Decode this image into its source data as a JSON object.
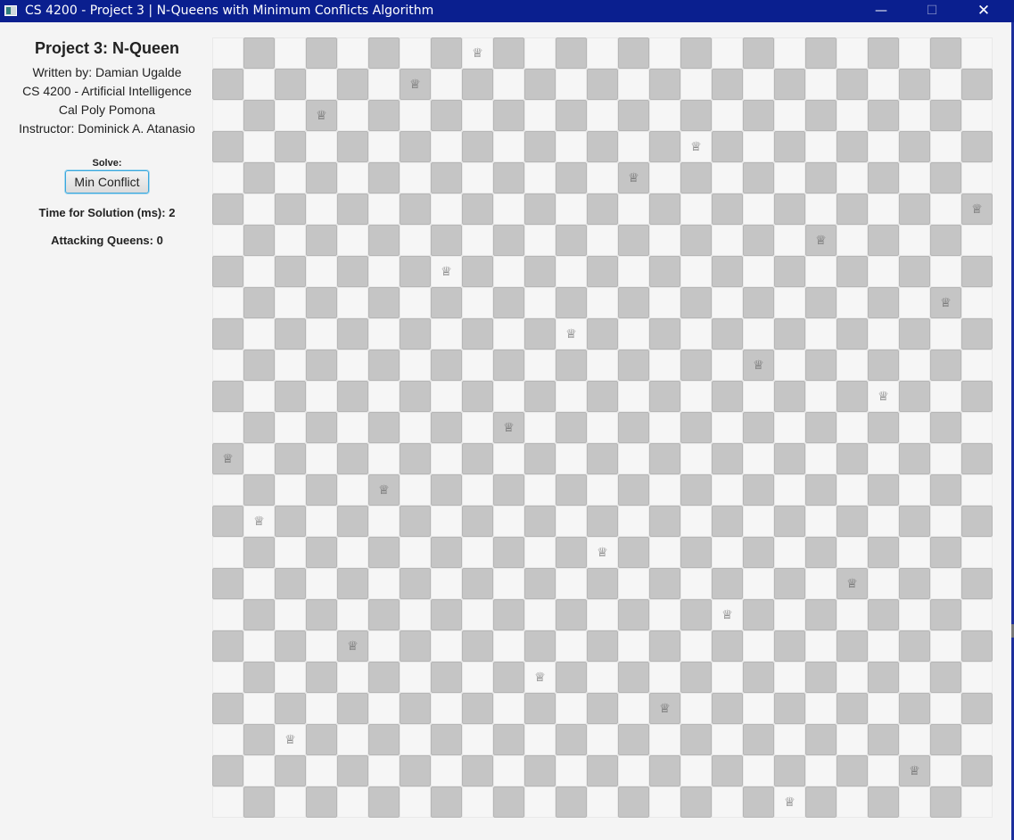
{
  "window": {
    "title": "CS 4200 - Project 3 | N-Queens with Minimum Conflicts Algorithm",
    "minimize_icon": "—",
    "maximize_icon": "☐",
    "close_icon": "✕"
  },
  "sidebar": {
    "title": "Project 3: N-Queen",
    "author": "Written by: Damian Ugalde",
    "course": "CS 4200 - Artificial Intelligence",
    "school": "Cal Poly Pomona",
    "instructor": "Instructor: Dominick A. Atanasio",
    "solve_label": "Solve:",
    "solve_button": "Min Conflict",
    "time_label": "Time for Solution (ms): 2",
    "attacking_label": "Attacking Queens: 0"
  },
  "board": {
    "size": 25,
    "queen_glyph": "♕",
    "light_color": "#f6f6f6",
    "dark_color": "#c5c5c5",
    "queen_columns_by_row": [
      8,
      6,
      3,
      15,
      13,
      24,
      19,
      7,
      23,
      11,
      17,
      21,
      9,
      0,
      5,
      1,
      12,
      20,
      16,
      4,
      10,
      14,
      2,
      22,
      18
    ]
  }
}
